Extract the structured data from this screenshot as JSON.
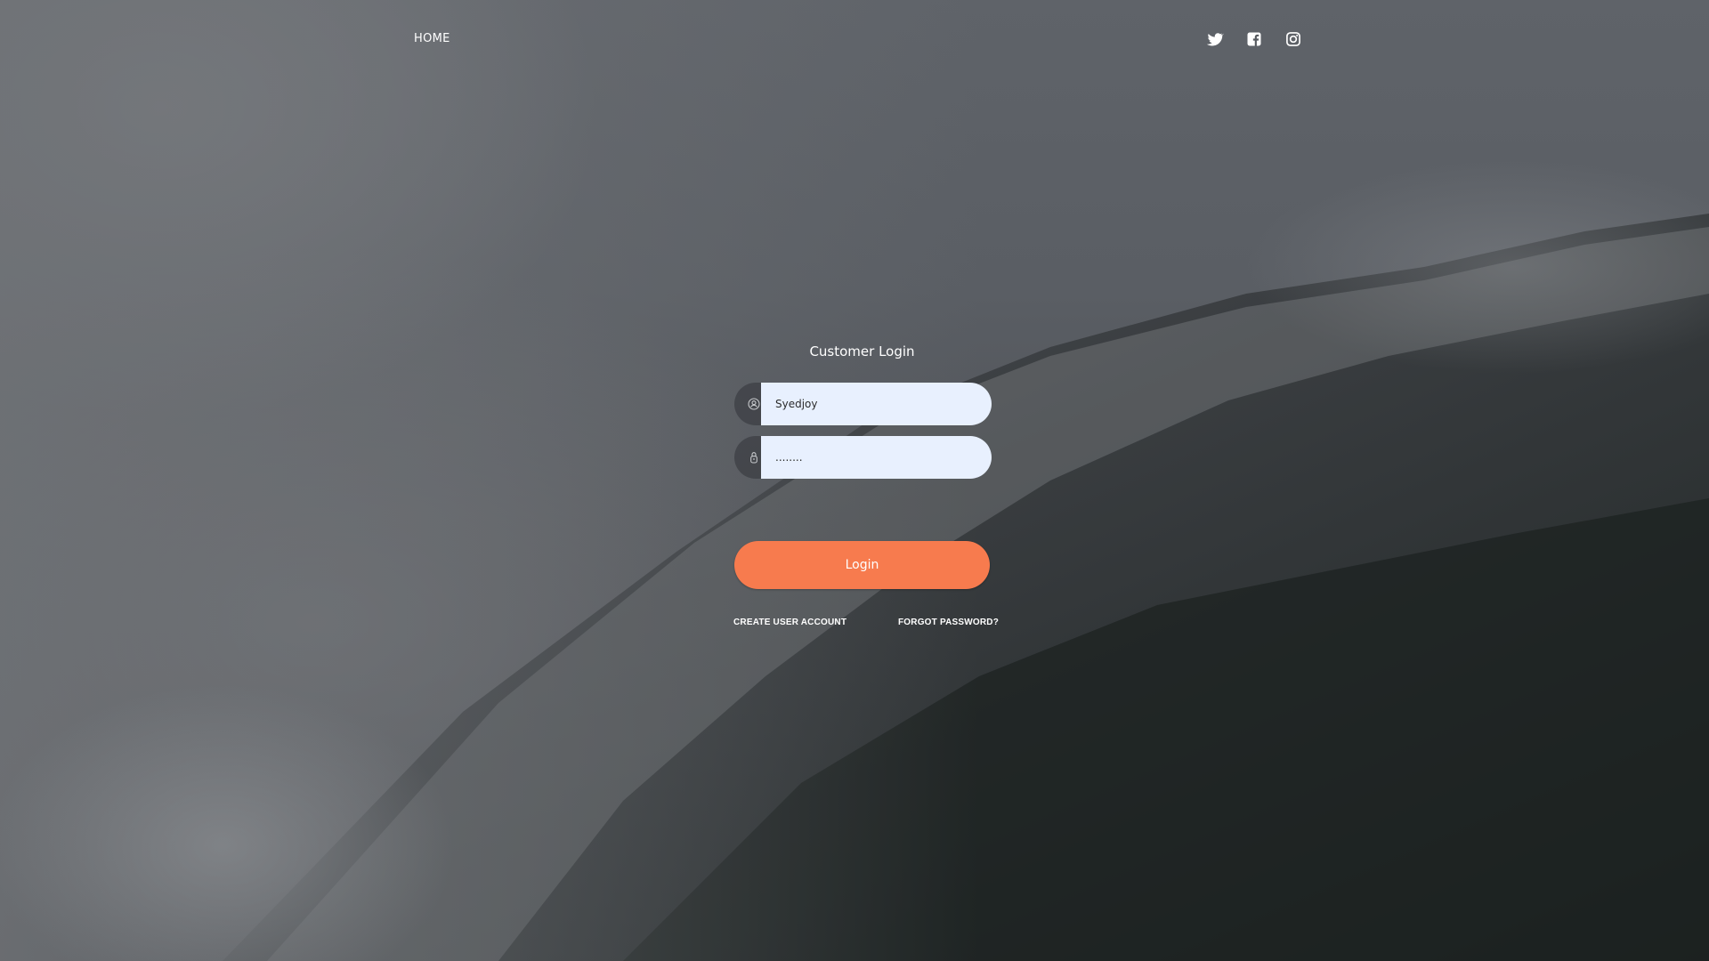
{
  "nav": {
    "home_label": "HOME",
    "social_icons": [
      "twitter-icon",
      "facebook-icon",
      "instagram-icon"
    ]
  },
  "login": {
    "title": "Customer Login",
    "username_value": "Syedjoy",
    "password_value": "........",
    "button_label": "Login",
    "create_account_label": "CREATE USER ACCOUNT",
    "forgot_password_label": "FORGOT PASSWORD?"
  },
  "colors": {
    "accent": "#f77b4e",
    "input_background": "#e8f0fe",
    "text": "#ffffff"
  }
}
